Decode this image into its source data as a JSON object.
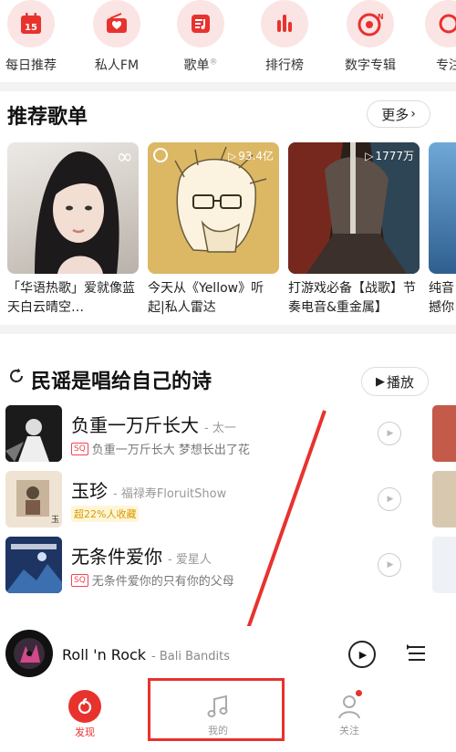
{
  "topnav": {
    "items": [
      {
        "label": "每日推荐",
        "icon": "calendar-icon",
        "badge": "15"
      },
      {
        "label": "私人FM",
        "icon": "radio-icon"
      },
      {
        "label": "歌单",
        "icon": "playlist-icon",
        "mark": "®"
      },
      {
        "label": "排行榜",
        "icon": "chart-bars-icon"
      },
      {
        "label": "数字专辑",
        "icon": "digital-album-icon"
      },
      {
        "label": "专注",
        "icon": "focus-icon"
      }
    ]
  },
  "recommended": {
    "title": "推荐歌单",
    "more_label": "更多",
    "playlists": [
      {
        "title": "「华语热歌」爱就像蓝天白云晴空…",
        "play_count": ""
      },
      {
        "title": "今天从《Yellow》听起|私人雷达",
        "play_count": "93.4亿"
      },
      {
        "title": "打游戏必备【战歌】节奏电音&重金属】",
        "play_count": "1777万"
      },
      {
        "title": "纯音撼你",
        "play_count": ""
      }
    ]
  },
  "folk": {
    "title": "民谣是唱给自己的诗",
    "play_label": "播放",
    "songs": [
      {
        "name": "负重一万斤长大",
        "artist": "- 太一",
        "quality": "SQ",
        "subtitle": "负重一万斤长大 梦想长出了花",
        "tag": ""
      },
      {
        "name": "玉珍",
        "artist": "- 福禄寿FloruitShow",
        "quality": "",
        "subtitle": "",
        "tag": "超22%人收藏"
      },
      {
        "name": "无条件爱你",
        "artist": "- 爱星人",
        "quality": "SQ",
        "subtitle": "无条件爱你的只有你的父母",
        "tag": ""
      }
    ]
  },
  "player": {
    "title": "Roll 'n Rock",
    "artist": "- Bali Bandits"
  },
  "tabbar": {
    "discover": "发现",
    "mine": "我的",
    "follow": "关注"
  },
  "colors": {
    "brand_red": "#e8322e",
    "nav_circle_bg": "#fbe4e4",
    "separator": "#f3f3f3"
  }
}
